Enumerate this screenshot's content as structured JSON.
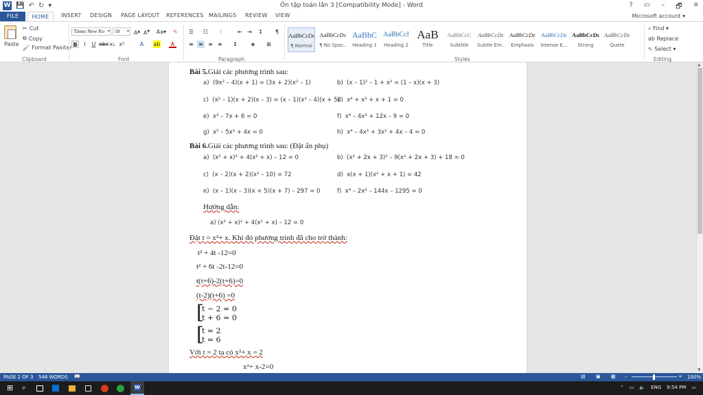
{
  "app": {
    "title": "Ôn tập toán lần 3 [Compatibility Mode] - Word",
    "help": "?",
    "window_controls": [
      "▭",
      "–",
      "🗗",
      "✕"
    ],
    "account": "Microsoft account ▾"
  },
  "quick_access": {
    "undo": "↶",
    "redo": "↻",
    "customize": "▾"
  },
  "tabs": [
    "FILE",
    "HOME",
    "INSERT",
    "DESIGN",
    "PAGE LAYOUT",
    "REFERENCES",
    "MAILINGS",
    "REVIEW",
    "VIEW"
  ],
  "ribbon": {
    "clipboard": {
      "paste": "Paste",
      "cut": "Cut",
      "copy": "Copy",
      "format_painter": "Format Painter",
      "label": "Clipboard"
    },
    "font": {
      "name": "Times New Ro",
      "size": "18",
      "label": "Font"
    },
    "paragraph": {
      "label": "Paragraph"
    },
    "styles": {
      "label": "Styles",
      "items": [
        {
          "preview": "AaBbCcDc",
          "name": "¶ Normal"
        },
        {
          "preview": "AaBbCcDc",
          "name": "¶ No Spac..."
        },
        {
          "preview": "AaBbC",
          "name": "Heading 1"
        },
        {
          "preview": "AaBbCcI",
          "name": "Heading 2"
        },
        {
          "preview": "AaB",
          "name": "Title"
        },
        {
          "preview": "AaBbCcC",
          "name": "Subtitle"
        },
        {
          "preview": "AaBbCcDc",
          "name": "Subtle Em..."
        },
        {
          "preview": "AaBbCcDc",
          "name": "Emphasis"
        },
        {
          "preview": "AaBbCcDc",
          "name": "Intense E..."
        },
        {
          "preview": "AaBbCcDc",
          "name": "Strong"
        },
        {
          "preview": "AaBbCcDc",
          "name": "Quote"
        }
      ]
    },
    "editing": {
      "find": "Find ▾",
      "replace": "Replace",
      "select": "Select ▾",
      "label": "Editing"
    }
  },
  "document": {
    "bai5_num": "Bài 5.",
    "bai5_rest": "Giải các phương trình sau:",
    "bai5": [
      {
        "l": "a)",
        "e": "(9x² – 4)(x + 1) = (3x + 2)(x² – 1)"
      },
      {
        "l": "b)",
        "e": "(x – 1)² – 1 + x² = (1 – x)(x + 3)"
      },
      {
        "l": "c)",
        "e": "(x² – 1)(x + 2)(x – 3) = (x – 1)(x² – 4)(x + 5)"
      },
      {
        "l": "d)",
        "e": "x⁴ + x³ + x + 1 = 0"
      },
      {
        "l": "e)",
        "e": "x³ – 7x + 6 = 0"
      },
      {
        "l": "f)",
        "e": "x⁴ – 4x³ + 12x – 9 = 0"
      },
      {
        "l": "g)",
        "e": "x⁵ – 5x³ + 4x = 0"
      },
      {
        "l": "h)",
        "e": "x⁴ – 4x³ + 3x² + 4x – 4 = 0"
      }
    ],
    "bai6_num": "Bài 6.",
    "bai6_rest": "Giải các phương trình sau: (Đặt ẩn phụ)",
    "bai6": [
      {
        "l": "a)",
        "e": "(x² + x)² + 4(x² + x) – 12 = 0"
      },
      {
        "l": "b)",
        "e": "(x² + 2x + 3)² – 9(x² + 2x + 3) + 18 = 0"
      },
      {
        "l": "c)",
        "e": "(x – 2)(x + 2)(x² – 10) = 72"
      },
      {
        "l": "d)",
        "e": "x(x + 1)(x² + x + 1) = 42"
      },
      {
        "l": "e)",
        "e": "(x – 1)(x – 3)(x + 5)(x + 7) – 297 = 0"
      },
      {
        "l": "f)",
        "e": "x⁴ – 2x² – 144x – 1295 = 0"
      }
    ],
    "guide": "Hướng dẫn:",
    "guide_a": "a)  (x² + x)² + 4(x² + x) – 12 = 0",
    "sub_line": "Đặt t = x²+ x. Khi đó phương trình đã cho trở thành:",
    "steps": [
      "t² + 4t -12=0",
      "t² + 6t -2t-12=0",
      "t(t+6)-2(t+6)=0",
      "(t-2)(t+6) =0"
    ],
    "sys1": [
      "t − 2 = 0",
      "t + 6 = 0"
    ],
    "sys2": [
      "t = 2",
      "t = 6"
    ],
    "with_t": "Với t = 2 ta có x²+ x = 2",
    "last": "x²+ x-2=0"
  },
  "status": {
    "page": "PAGE 2 OF 3",
    "words": "548 WORDS",
    "zoom": "100%"
  },
  "taskbar": {
    "time": "9:54 PM"
  }
}
